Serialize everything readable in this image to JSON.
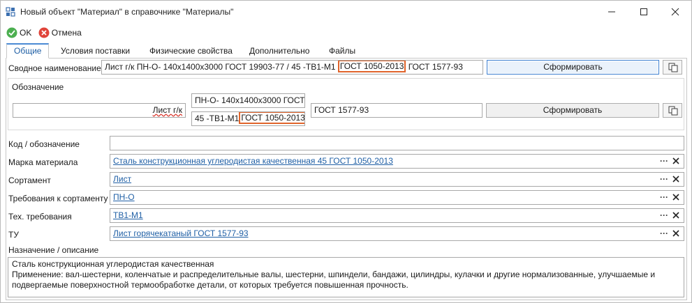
{
  "window": {
    "title": "Новый объект \"Материал\" в справочнике \"Материалы\""
  },
  "toolbar": {
    "ok_label": "OK",
    "cancel_label": "Отмена"
  },
  "tabs": [
    {
      "label": "Общие",
      "active": true
    },
    {
      "label": "Условия поставки",
      "active": false
    },
    {
      "label": "Физические свойства",
      "active": false
    },
    {
      "label": "Дополнительно",
      "active": false
    },
    {
      "label": "Файлы",
      "active": false
    }
  ],
  "summary_name": {
    "label": "Сводное наименование",
    "value_part1": "Лист г/к ПН-О- 140х1400х3000 ГОСТ 19903-77 / 45 -ТВ1-М1",
    "value_highlight": "ГОСТ 1050-2013",
    "value_part2": "ГОСТ 1577-93",
    "generate_label": "Сформировать"
  },
  "designation": {
    "group_label": "Обозначение",
    "left_value": "Лист г/к",
    "stack_top": "ПН-О- 140х1400х3000 ГОСТ",
    "stack_bottom_prefix": "45 -ТВ1-М1",
    "stack_bottom_highlight": "ГОСТ 1050-2013",
    "right_value": "ГОСТ 1577-93",
    "generate_label": "Сформировать"
  },
  "fields": {
    "code_label": "Код / обозначение",
    "code_value": "",
    "grade_label": "Марка материала",
    "grade_value": "Сталь конструкционная углеродистая качественная 45 ГОСТ 1050-2013",
    "assortment_label": "Сортамент",
    "assortment_value": "Лист",
    "assortment_req_label": "Требования к сортаменту",
    "assortment_req_value": "ПН-О",
    "tech_req_label": "Тех. требования",
    "tech_req_value": "ТВ1-М1",
    "tu_label": "ТУ",
    "tu_value": "Лист горячекатаный ГОСТ 1577-93",
    "ellipsis": "···",
    "purpose_label": "Назначение / описание",
    "purpose_lines": [
      "Сталь конструкционная углеродистая качественная",
      "Применение: вал-шестерни, коленчатые и распределительные валы, шестерни, шпиндели, бандажи, цилиндры, кулачки и другие нормализованные, улучшаемые и",
      "подвергаемые поверхностной термообработке детали, от которых требуется повышенная прочность."
    ]
  },
  "colors": {
    "accent": "#4a8ad4",
    "highlight": "#e0642b",
    "ok_green": "#4caf50",
    "cancel_red": "#e0443a",
    "link": "#1f5fa5"
  },
  "icons": {
    "app": "catalog-icon",
    "ok": "check-circle-icon",
    "cancel": "x-circle-icon",
    "copy": "copy-icon",
    "clear": "close-icon"
  }
}
